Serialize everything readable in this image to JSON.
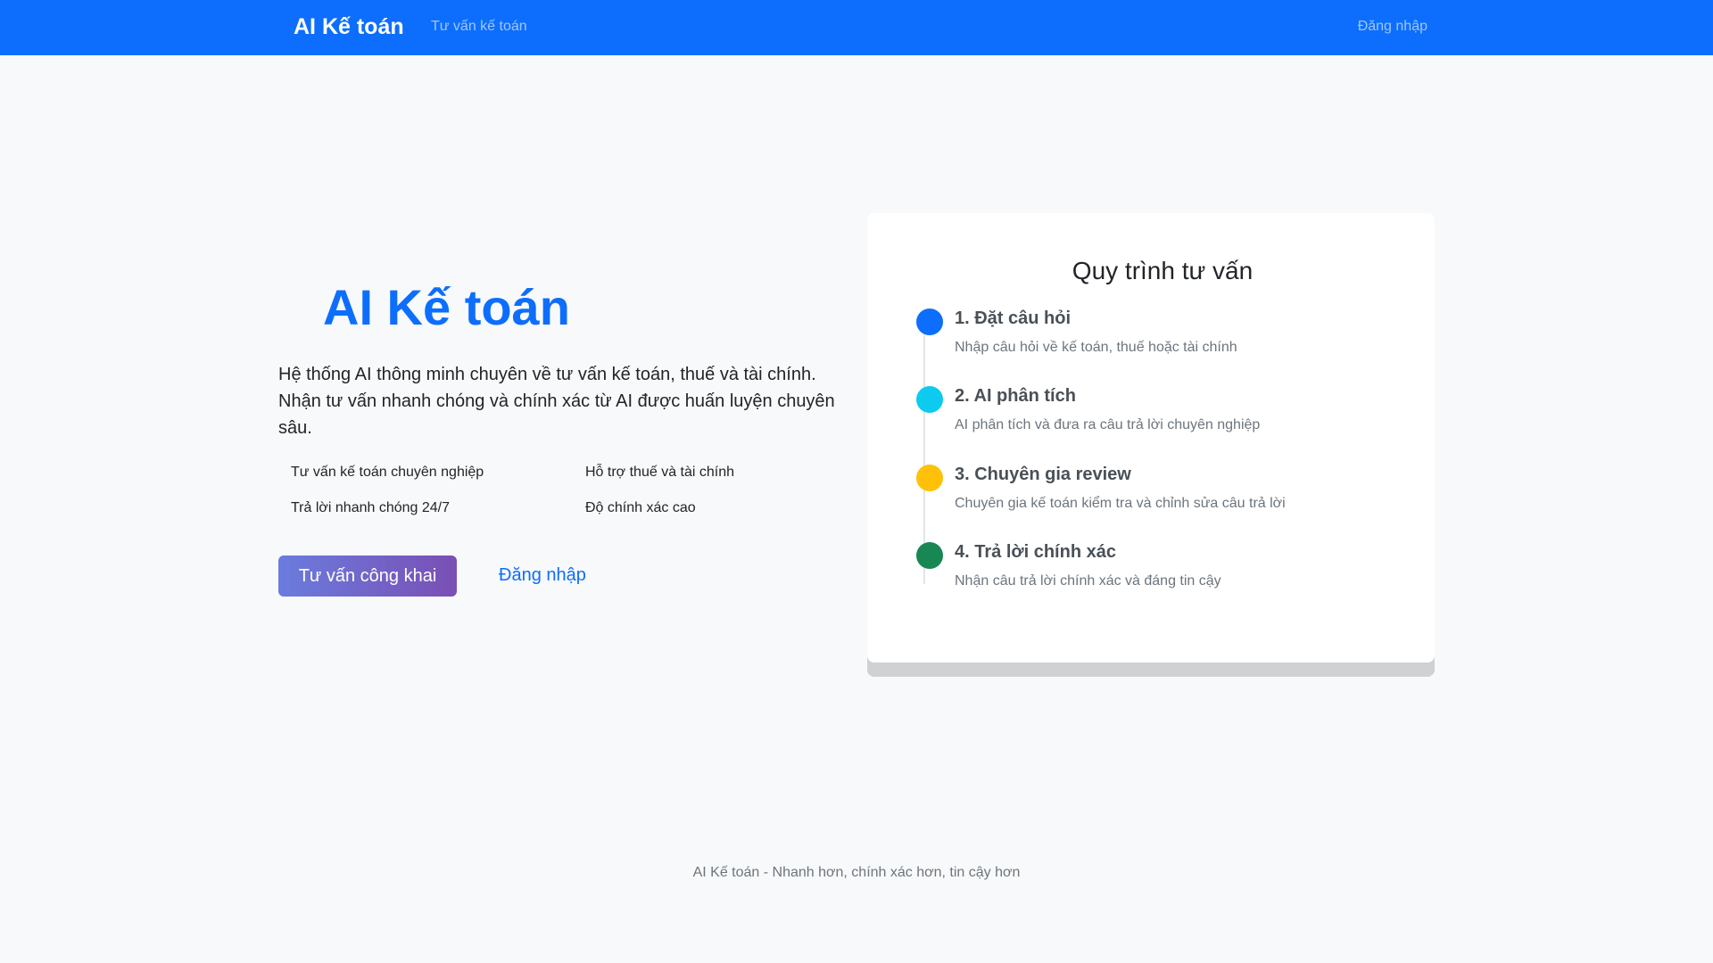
{
  "navbar": {
    "brand": "AI Kế toán",
    "links": {
      "consult": "Tư vấn kế toán",
      "login": "Đăng nhập"
    }
  },
  "hero": {
    "title": "AI Kế toán",
    "lead": "Hệ thống AI thông minh chuyên về tư vấn kế toán, thuế và tài chính. Nhận tư vấn nhanh chóng và chính xác từ AI được huấn luyện chuyên sâu.",
    "features": [
      "Tư vấn kế toán chuyên nghiệp",
      "Hỗ trợ thuế và tài chính",
      "Trả lời nhanh chóng 24/7",
      "Độ chính xác cao"
    ],
    "primary_button": "Tư vấn công khai",
    "secondary_button": "Đăng nhập"
  },
  "process": {
    "title": "Quy trình tư vấn",
    "steps": [
      {
        "title": "1. Đặt câu hỏi",
        "description": "Nhập câu hỏi về kế toán, thuế hoặc tài chính",
        "color": "#0d6efd"
      },
      {
        "title": "2. AI phân tích",
        "description": "AI phân tích và đưa ra câu trả lời chuyên nghiệp",
        "color": "#0dcaf0"
      },
      {
        "title": "3. Chuyên gia review",
        "description": "Chuyên gia kế toán kiểm tra và chỉnh sửa câu trả lời",
        "color": "#ffc107"
      },
      {
        "title": "4. Trả lời chính xác",
        "description": "Nhận câu trả lời chính xác và đáng tin cậy",
        "color": "#198754"
      }
    ]
  },
  "footer": {
    "text": "AI Kế toán - Nhanh hơn, chính xác hơn, tin cậy hơn"
  },
  "colors": {
    "primary": "#0d6efd",
    "navbar": "#0d6efd",
    "background": "#f8f9fa"
  }
}
